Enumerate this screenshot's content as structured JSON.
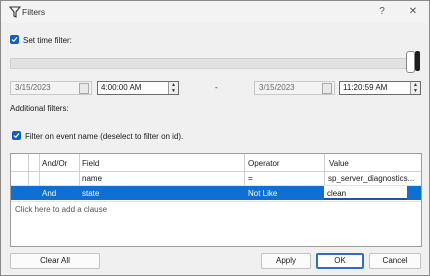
{
  "window": {
    "title": "Filters",
    "help_btn": "?",
    "close_btn": "✕"
  },
  "time_filter": {
    "checkbox_label": "Set time filter:",
    "checked": true,
    "start_date": "3/15/2023",
    "start_time": "4:00:00 AM",
    "separator": "-",
    "end_date": "3/15/2023",
    "end_time": "11:20:59 AM"
  },
  "additional_filters_label": "Additional filters:",
  "event_name_filter": {
    "checkbox_label": "Filter on event name (deselect to filter on id).",
    "checked": true
  },
  "grid": {
    "columns": [
      "And/Or",
      "Field",
      "Operator",
      "Value"
    ],
    "rows": [
      {
        "andor": "",
        "field": "name",
        "operator": "=",
        "value": "sp_server_diagnostics..."
      },
      {
        "andor": "And",
        "field": "state",
        "operator": "Not Like",
        "value": "clean"
      }
    ],
    "add_clause": "Click here to add a clause"
  },
  "buttons": {
    "clear_all": "Clear All",
    "apply": "Apply",
    "ok": "OK",
    "cancel": "Cancel"
  },
  "colors": {
    "accent": "#0f6fd2",
    "checkbox": "#0f5fc7"
  }
}
